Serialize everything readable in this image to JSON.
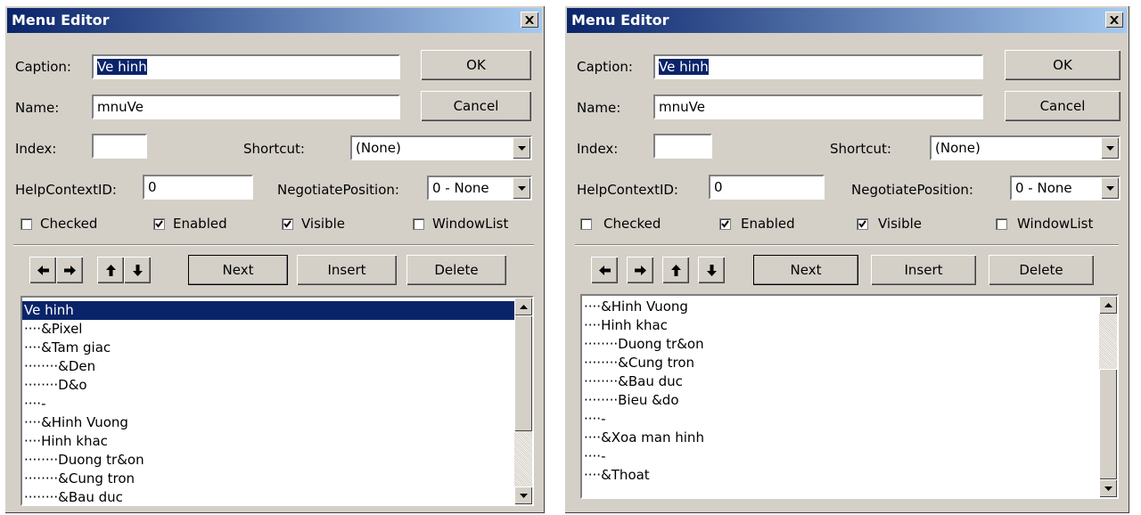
{
  "left": {
    "title": "Menu Editor",
    "caption_label": "Caption:",
    "caption_value": "Ve hinh",
    "name_label": "Name:",
    "name_value": "mnuVe",
    "index_label": "Index:",
    "index_value": "",
    "shortcut_label": "Shortcut:",
    "shortcut_value": "(None)",
    "helpcontext_label": "HelpContextID:",
    "helpcontext_value": "0",
    "negotiate_label": "NegotiatePosition:",
    "negotiate_value": "0 - None",
    "ok_label": "OK",
    "cancel_label": "Cancel",
    "checked_label": "Checked",
    "checked_state": false,
    "enabled_label": "Enabled",
    "enabled_state": true,
    "visible_label": "Visible",
    "visible_state": true,
    "windowlist_label": "WindowList",
    "windowlist_state": false,
    "next_label": "Next",
    "insert_label": "Insert",
    "delete_label": "Delete",
    "menu_items": [
      "Ve hinh",
      "····&Pixel",
      "····&Tam giac",
      "········&Den",
      "········D&o",
      "····-",
      "····&Hinh Vuong",
      "····Hinh khac",
      "········Duong tr&on",
      "········&Cung tron",
      "········&Bau duc"
    ],
    "selected_index": 0,
    "scroll_fraction": 0.0
  },
  "right": {
    "title": "Menu Editor",
    "caption_label": "Caption:",
    "caption_value": "Ve hinh",
    "name_label": "Name:",
    "name_value": "mnuVe",
    "index_label": "Index:",
    "index_value": "",
    "shortcut_label": "Shortcut:",
    "shortcut_value": "(None)",
    "helpcontext_label": "HelpContextID:",
    "helpcontext_value": "0",
    "negotiate_label": "NegotiatePosition:",
    "negotiate_value": "0 - None",
    "ok_label": "OK",
    "cancel_label": "Cancel",
    "checked_label": "Checked",
    "checked_state": false,
    "enabled_label": "Enabled",
    "enabled_state": true,
    "visible_label": "Visible",
    "visible_state": true,
    "windowlist_label": "WindowList",
    "windowlist_state": false,
    "next_label": "Next",
    "insert_label": "Insert",
    "delete_label": "Delete",
    "menu_items": [
      "····&Hinh Vuong",
      "····Hinh khac",
      "········Duong tr&on",
      "········&Cung tron",
      "········&Bau duc",
      "········Bieu &do",
      "····-",
      "····&Xoa man hinh",
      "····-",
      "····&Thoat"
    ],
    "selected_index": -1,
    "scroll_fraction": 1.0
  }
}
